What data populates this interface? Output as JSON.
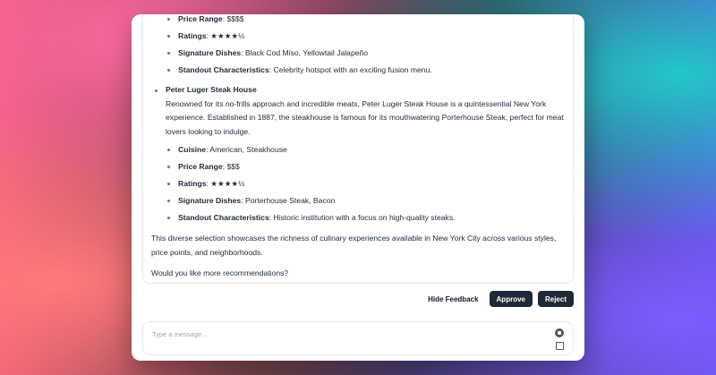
{
  "first_restaurant": {
    "details": [
      {
        "label": "Price Range",
        "value": ": $$$$"
      },
      {
        "label": "Ratings",
        "value": ": ★★★★½"
      },
      {
        "label": "Signature Dishes",
        "value": ": Black Cod Miso, Yellowtail Jalapeño"
      },
      {
        "label": "Standout Characteristics",
        "value": ": Celebrity hotspot with an exciting fusion menu."
      }
    ]
  },
  "second_restaurant": {
    "name": "Peter Luger Steak House",
    "description": "Renowned for its no-frills approach and incredible meats, Peter Luger Steak House is a quintessential New York experience. Established in 1887, the steakhouse is famous for its mouthwatering Porterhouse Steak, perfect for meat lovers looking to indulge.",
    "details": [
      {
        "label": "Cuisine",
        "value": ": American, Steakhouse"
      },
      {
        "label": "Price Range",
        "value": ": $$$"
      },
      {
        "label": "Ratings",
        "value": ": ★★★★½"
      },
      {
        "label": "Signature Dishes",
        "value": ": Porterhouse Steak, Bacon"
      },
      {
        "label": "Standout Characteristics",
        "value": ": Historic institution with a focus on high-quality steaks."
      }
    ]
  },
  "closing_text": "This diverse selection showcases the richness of culinary experiences available in New York City across various styles, price points, and neighborhoods.",
  "question_text": "Would you like more recommendations?",
  "actions": {
    "hide_feedback": "Hide Feedback",
    "approve": "Approve",
    "reject": "Reject"
  },
  "composer": {
    "placeholder": "Type a message...",
    "send_icon": "send-icon"
  }
}
